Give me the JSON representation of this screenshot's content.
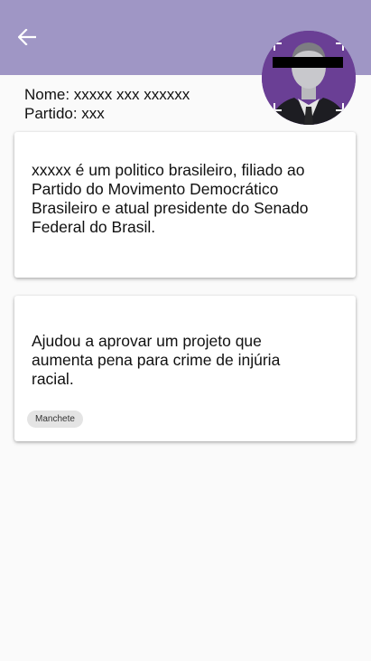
{
  "header": {
    "back_icon": "arrow-left-icon",
    "bg_color": "#9f96c5"
  },
  "avatar": {
    "icon": "politician-photo-icon"
  },
  "profile": {
    "name_line": "Nome: xxxxx xxx xxxxxx",
    "party_line": "Partido: xxx"
  },
  "cards": [
    {
      "text": "xxxxx é um politico brasileiro, filiado ao Partido do Movimento Democrático Brasileiro e atual presidente do Senado Federal do Brasil."
    },
    {
      "text": "Ajudou a aprovar um projeto que aumenta pena para crime de injúria racial.",
      "tag": "Manchete"
    }
  ]
}
